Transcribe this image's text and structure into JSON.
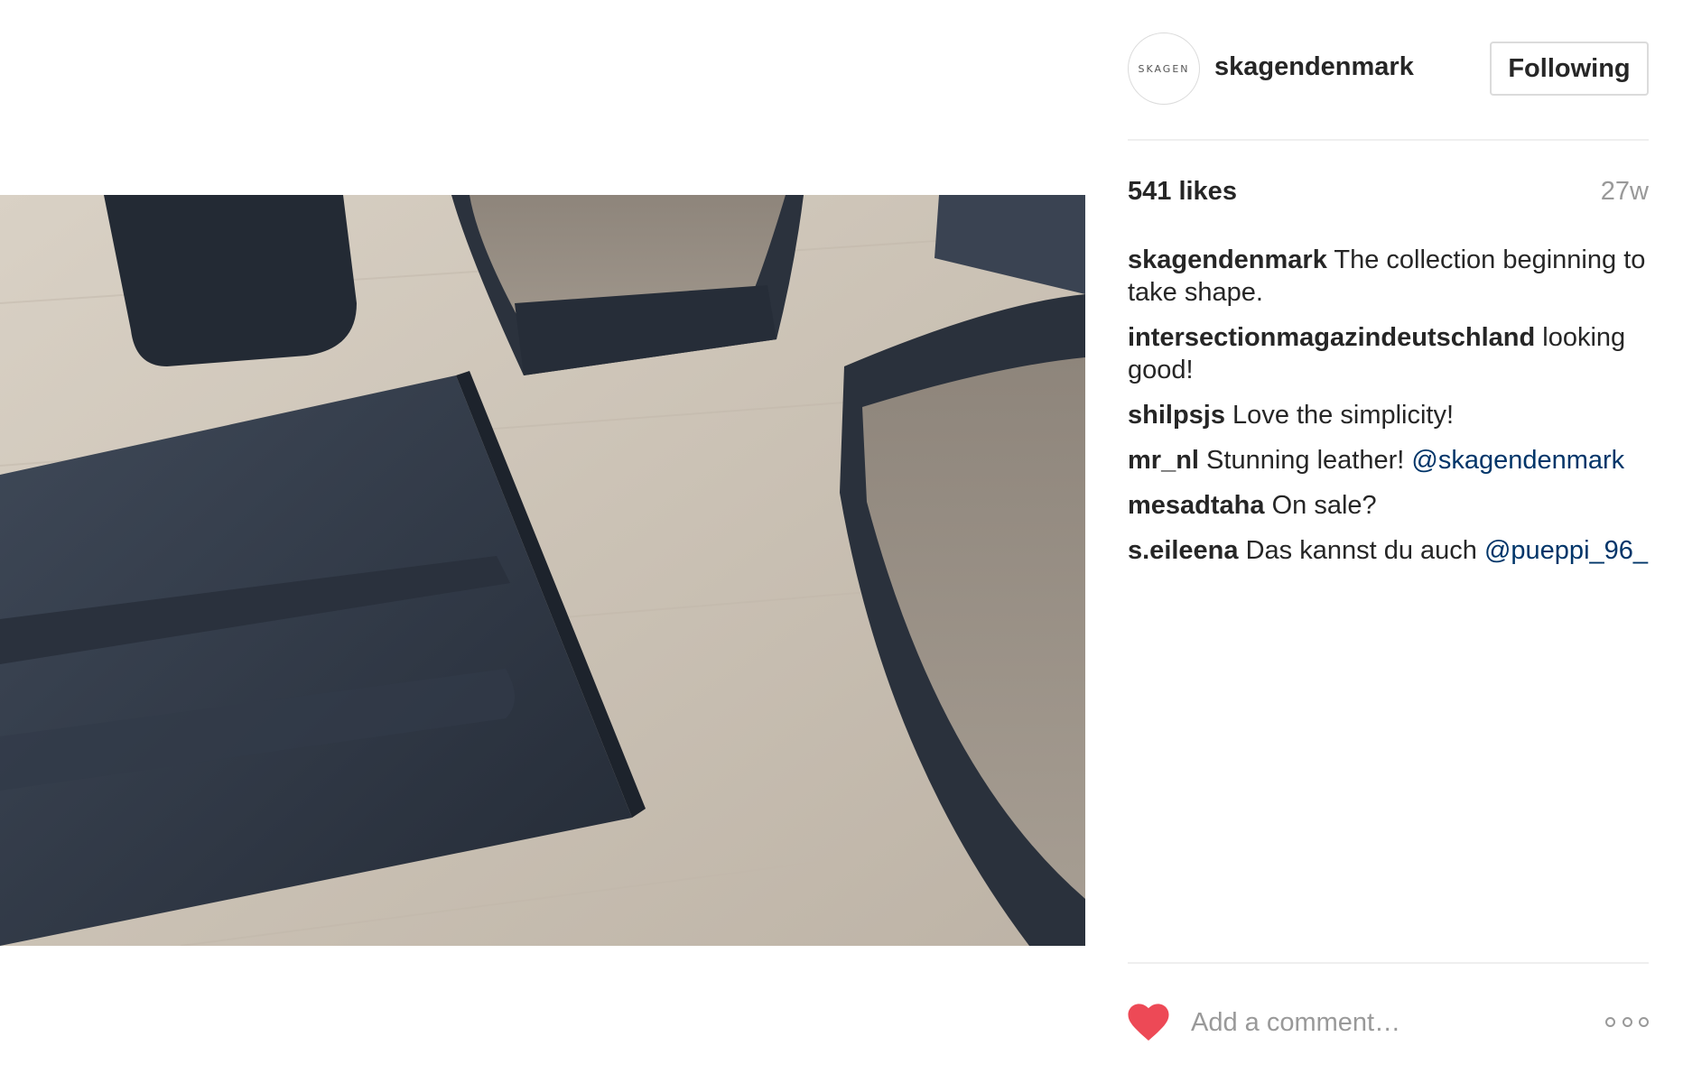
{
  "post": {
    "photo_alt": "Dark leather goods on a wooden table",
    "author": {
      "avatar_text": "SKAGEN",
      "username": "skagendenmark"
    },
    "follow_button": "Following",
    "likes": "541 likes",
    "time_ago": "27w",
    "comments": [
      {
        "user": "skagendenmark",
        "text": " The collection beginning to take shape."
      },
      {
        "user": "intersectionmagazindeutschland",
        "text": " looking good!"
      },
      {
        "user": "shilpsjs",
        "text": " Love the simplicity!"
      },
      {
        "user": "mr_nl",
        "text": " Stunning leather! ",
        "mention": "@skagendenmark"
      },
      {
        "user": "mesadtaha",
        "text": " On sale?"
      },
      {
        "user": "s.eileena",
        "text": " Das kannst du auch ",
        "mention": "@pueppi_96_"
      }
    ],
    "comment_placeholder": "Add a comment…",
    "liked": true
  },
  "colors": {
    "heart": "#ed4956",
    "mention": "#003569",
    "muted": "#999999",
    "divider": "#efefef"
  },
  "icons": {
    "like": "heart-icon",
    "more": "more-options-icon"
  }
}
